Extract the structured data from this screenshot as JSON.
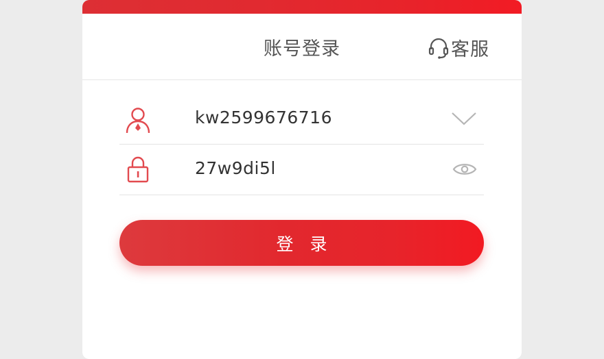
{
  "header": {
    "title": "账号登录",
    "service_label": "客服"
  },
  "form": {
    "username": "kw2599676716",
    "password": "27w9di5l"
  },
  "login_button": {
    "label": "登 录"
  },
  "icons": {
    "service": "headset-icon",
    "user": "user-icon",
    "dropdown": "chevron-down-icon",
    "lock": "lock-icon",
    "visibility": "eye-icon"
  },
  "colors": {
    "accent": "#e8232a",
    "icon_red": "#e24a4f",
    "text": "#333333",
    "muted_icon": "#b5b5b5"
  }
}
